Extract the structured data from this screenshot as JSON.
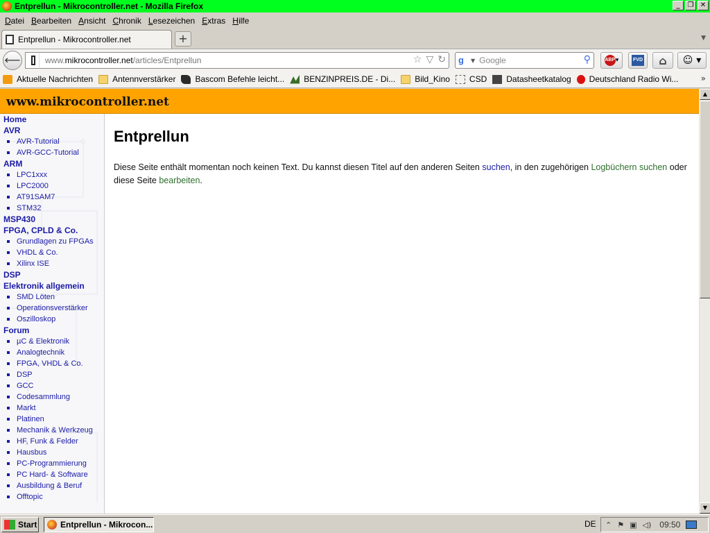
{
  "window": {
    "title": "Entprellun - Mikrocontroller.net - Mozilla Firefox"
  },
  "menu": [
    "Datei",
    "Bearbeiten",
    "Ansicht",
    "Chronik",
    "Lesezeichen",
    "Extras",
    "Hilfe"
  ],
  "tab": {
    "label": "Entprellun - Mikrocontroller.net",
    "new_tab": "+"
  },
  "url": {
    "prefix": "www.",
    "domain": "mikrocontroller.net",
    "path": "/articles/Entprellun"
  },
  "search": {
    "placeholder": "Google"
  },
  "toolbar": {
    "abp": "ABP",
    "fvd": "FVD"
  },
  "bookmarks": [
    {
      "icon": "rss-icon",
      "label": "Aktuelle Nachrichten"
    },
    {
      "icon": "folder-icon",
      "label": "Antennverstärker"
    },
    {
      "icon": "bascom-icon",
      "label": "Bascom Befehle leicht..."
    },
    {
      "icon": "benzinpreis-icon",
      "label": "BENZINPREIS.DE - Di..."
    },
    {
      "icon": "folder-icon",
      "label": "Bild_Kino"
    },
    {
      "icon": "dotted-icon",
      "label": "CSD"
    },
    {
      "icon": "chip-icon",
      "label": "Datasheetkatalog"
    },
    {
      "icon": "radio-icon",
      "label": "Deutschland Radio Wi..."
    }
  ],
  "site": {
    "title": "www.mikrocontroller.net"
  },
  "sidebar": [
    {
      "type": "section",
      "label": "Home"
    },
    {
      "type": "section",
      "label": "AVR"
    },
    {
      "type": "sub",
      "label": "AVR-Tutorial"
    },
    {
      "type": "sub",
      "label": "AVR-GCC-Tutorial"
    },
    {
      "type": "section",
      "label": "ARM"
    },
    {
      "type": "sub",
      "label": "LPC1xxx"
    },
    {
      "type": "sub",
      "label": "LPC2000"
    },
    {
      "type": "sub",
      "label": "AT91SAM7"
    },
    {
      "type": "sub",
      "label": "STM32"
    },
    {
      "type": "section",
      "label": "MSP430"
    },
    {
      "type": "section",
      "label": "FPGA, CPLD & Co."
    },
    {
      "type": "sub",
      "label": "Grundlagen zu FPGAs"
    },
    {
      "type": "sub",
      "label": "VHDL & Co."
    },
    {
      "type": "sub",
      "label": "Xilinx ISE"
    },
    {
      "type": "section",
      "label": "DSP"
    },
    {
      "type": "section",
      "label": "Elektronik allgemein"
    },
    {
      "type": "sub",
      "label": "SMD Löten"
    },
    {
      "type": "sub",
      "label": "Operationsverstärker"
    },
    {
      "type": "sub",
      "label": "Oszilloskop"
    },
    {
      "type": "section",
      "label": "Forum"
    },
    {
      "type": "sub",
      "label": "µC & Elektronik"
    },
    {
      "type": "sub",
      "label": "Analogtechnik"
    },
    {
      "type": "sub",
      "label": "FPGA, VHDL & Co."
    },
    {
      "type": "sub",
      "label": "DSP"
    },
    {
      "type": "sub",
      "label": "GCC"
    },
    {
      "type": "sub",
      "label": "Codesammlung"
    },
    {
      "type": "sub",
      "label": "Markt"
    },
    {
      "type": "sub",
      "label": "Platinen"
    },
    {
      "type": "sub",
      "label": "Mechanik & Werkzeug"
    },
    {
      "type": "sub",
      "label": "HF, Funk & Felder"
    },
    {
      "type": "sub",
      "label": "Hausbus"
    },
    {
      "type": "sub",
      "label": "PC-Programmierung"
    },
    {
      "type": "sub",
      "label": "PC Hard- & Software"
    },
    {
      "type": "sub",
      "label": "Ausbildung & Beruf"
    },
    {
      "type": "sub",
      "label": "Offtopic"
    }
  ],
  "article": {
    "heading": "Entprellun",
    "text_1": "Diese Seite enthält momentan noch keinen Text. Du kannst diesen Titel auf den anderen Seiten ",
    "link_search": "suchen",
    "text_2": ", in den zugehörigen ",
    "link_logs": "Logbüchern suchen",
    "text_3": " oder diese Seite ",
    "link_edit": "bearbeiten",
    "text_4": "."
  },
  "taskbar": {
    "start": "Start",
    "task": "Entprellun - Mikrocon...",
    "language": "DE",
    "clock": "09:50"
  },
  "colors": {
    "titlebar": "#00ff1f",
    "site_header": "#ffa300",
    "link_blue": "#1a1aa6",
    "link_green": "#2e6e2e"
  }
}
